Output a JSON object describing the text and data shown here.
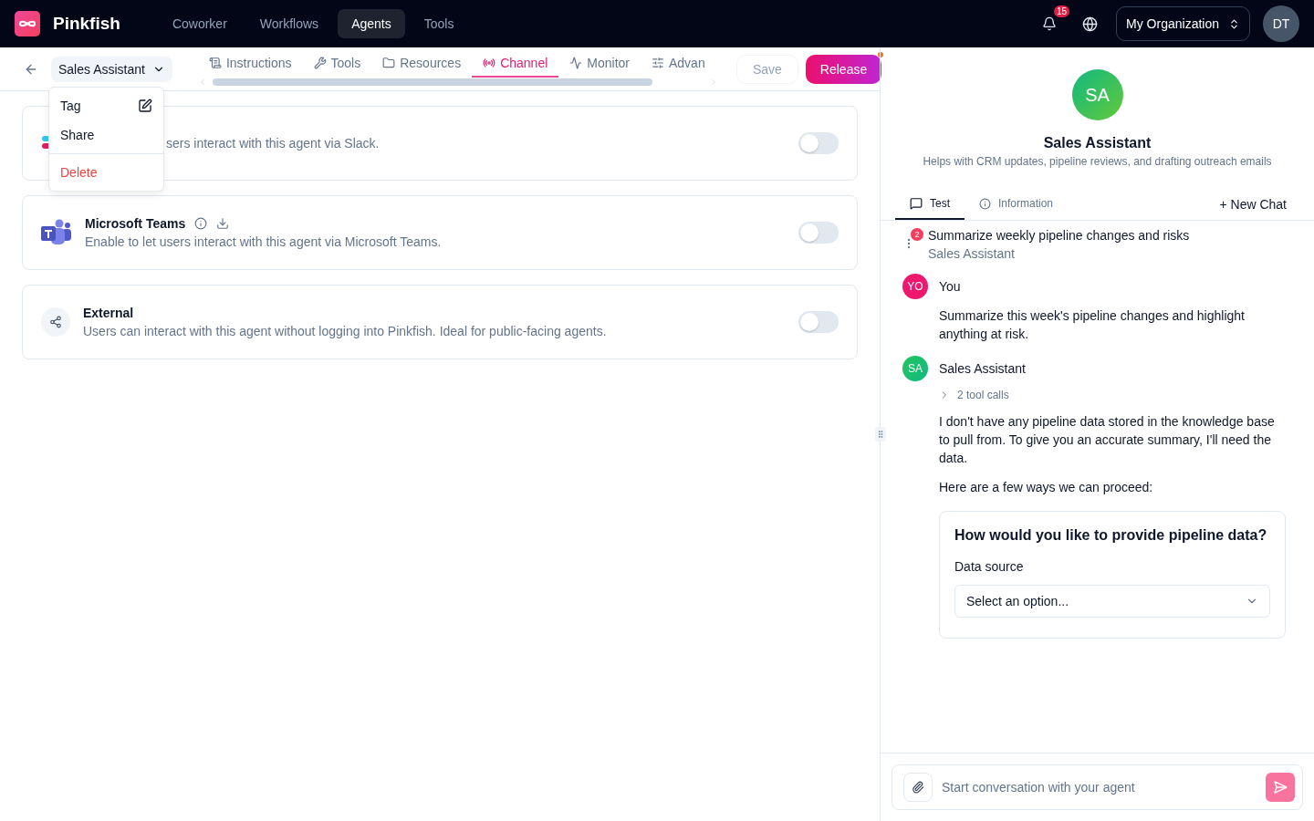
{
  "topnav": {
    "brand": "Pinkfish",
    "items": [
      {
        "label": "Coworker",
        "selected": false
      },
      {
        "label": "Workflows",
        "selected": false
      },
      {
        "label": "Agents",
        "selected": true
      },
      {
        "label": "Tools",
        "selected": false
      }
    ],
    "notifications": "15",
    "org": "My Organization",
    "avatar": "DT"
  },
  "subnav": {
    "agent": "Sales Assistant",
    "tabs": [
      {
        "label": "Instructions",
        "selected": false
      },
      {
        "label": "Tools",
        "selected": false
      },
      {
        "label": "Resources",
        "selected": false
      },
      {
        "label": "Channel",
        "selected": true
      },
      {
        "label": "Monitor",
        "selected": false
      },
      {
        "label": "Advan",
        "selected": false
      }
    ],
    "save": "Save",
    "release": "Release"
  },
  "menu": {
    "items": [
      {
        "label": "Tag",
        "kind": "edit"
      },
      {
        "label": "Share",
        "kind": "plain"
      },
      {
        "label": "Delete",
        "kind": "danger"
      }
    ]
  },
  "channels": [
    {
      "kind": "slack",
      "description": "sers interact with this agent via Slack.",
      "on": false
    },
    {
      "kind": "teams",
      "title": "Microsoft Teams",
      "description": "Enable to let users interact with this agent via Microsoft Teams.",
      "on": false
    },
    {
      "kind": "external",
      "title": "External",
      "description": "Users can interact with this agent without logging into Pinkfish. Ideal for public-facing agents.",
      "on": false
    }
  ],
  "agent_panel": {
    "avatar": "SA",
    "name": "Sales Assistant",
    "description": "Helps with CRM updates, pipeline reviews, and drafting outreach emails",
    "tabs": [
      {
        "label": "Test",
        "selected": true
      },
      {
        "label": "Information",
        "selected": false
      }
    ],
    "new_chat": "+ New Chat",
    "thread": {
      "badge": "2",
      "title": "Summarize weekly pipeline changes and risks",
      "subtitle": "Sales Assistant"
    },
    "messages": [
      {
        "kind": "user",
        "avatar": "YO",
        "author": "You",
        "paragraphs": [
          "Summarize this week's pipeline changes and highlight anything at risk."
        ]
      },
      {
        "kind": "agent",
        "avatar": "SA",
        "author": "Sales Assistant",
        "tool_calls": "2 tool calls",
        "paragraphs": [
          "I don't have any pipeline data stored in the knowledge base to pull from. To give you an accurate summary, I'll need the data.",
          "Here are a few ways we can proceed:"
        ],
        "form": {
          "title": "How would you like to provide pipeline data?",
          "label": "Data source",
          "placeholder": "Select an option..."
        }
      }
    ],
    "composer": {
      "placeholder": "Start conversation with your agent"
    }
  }
}
